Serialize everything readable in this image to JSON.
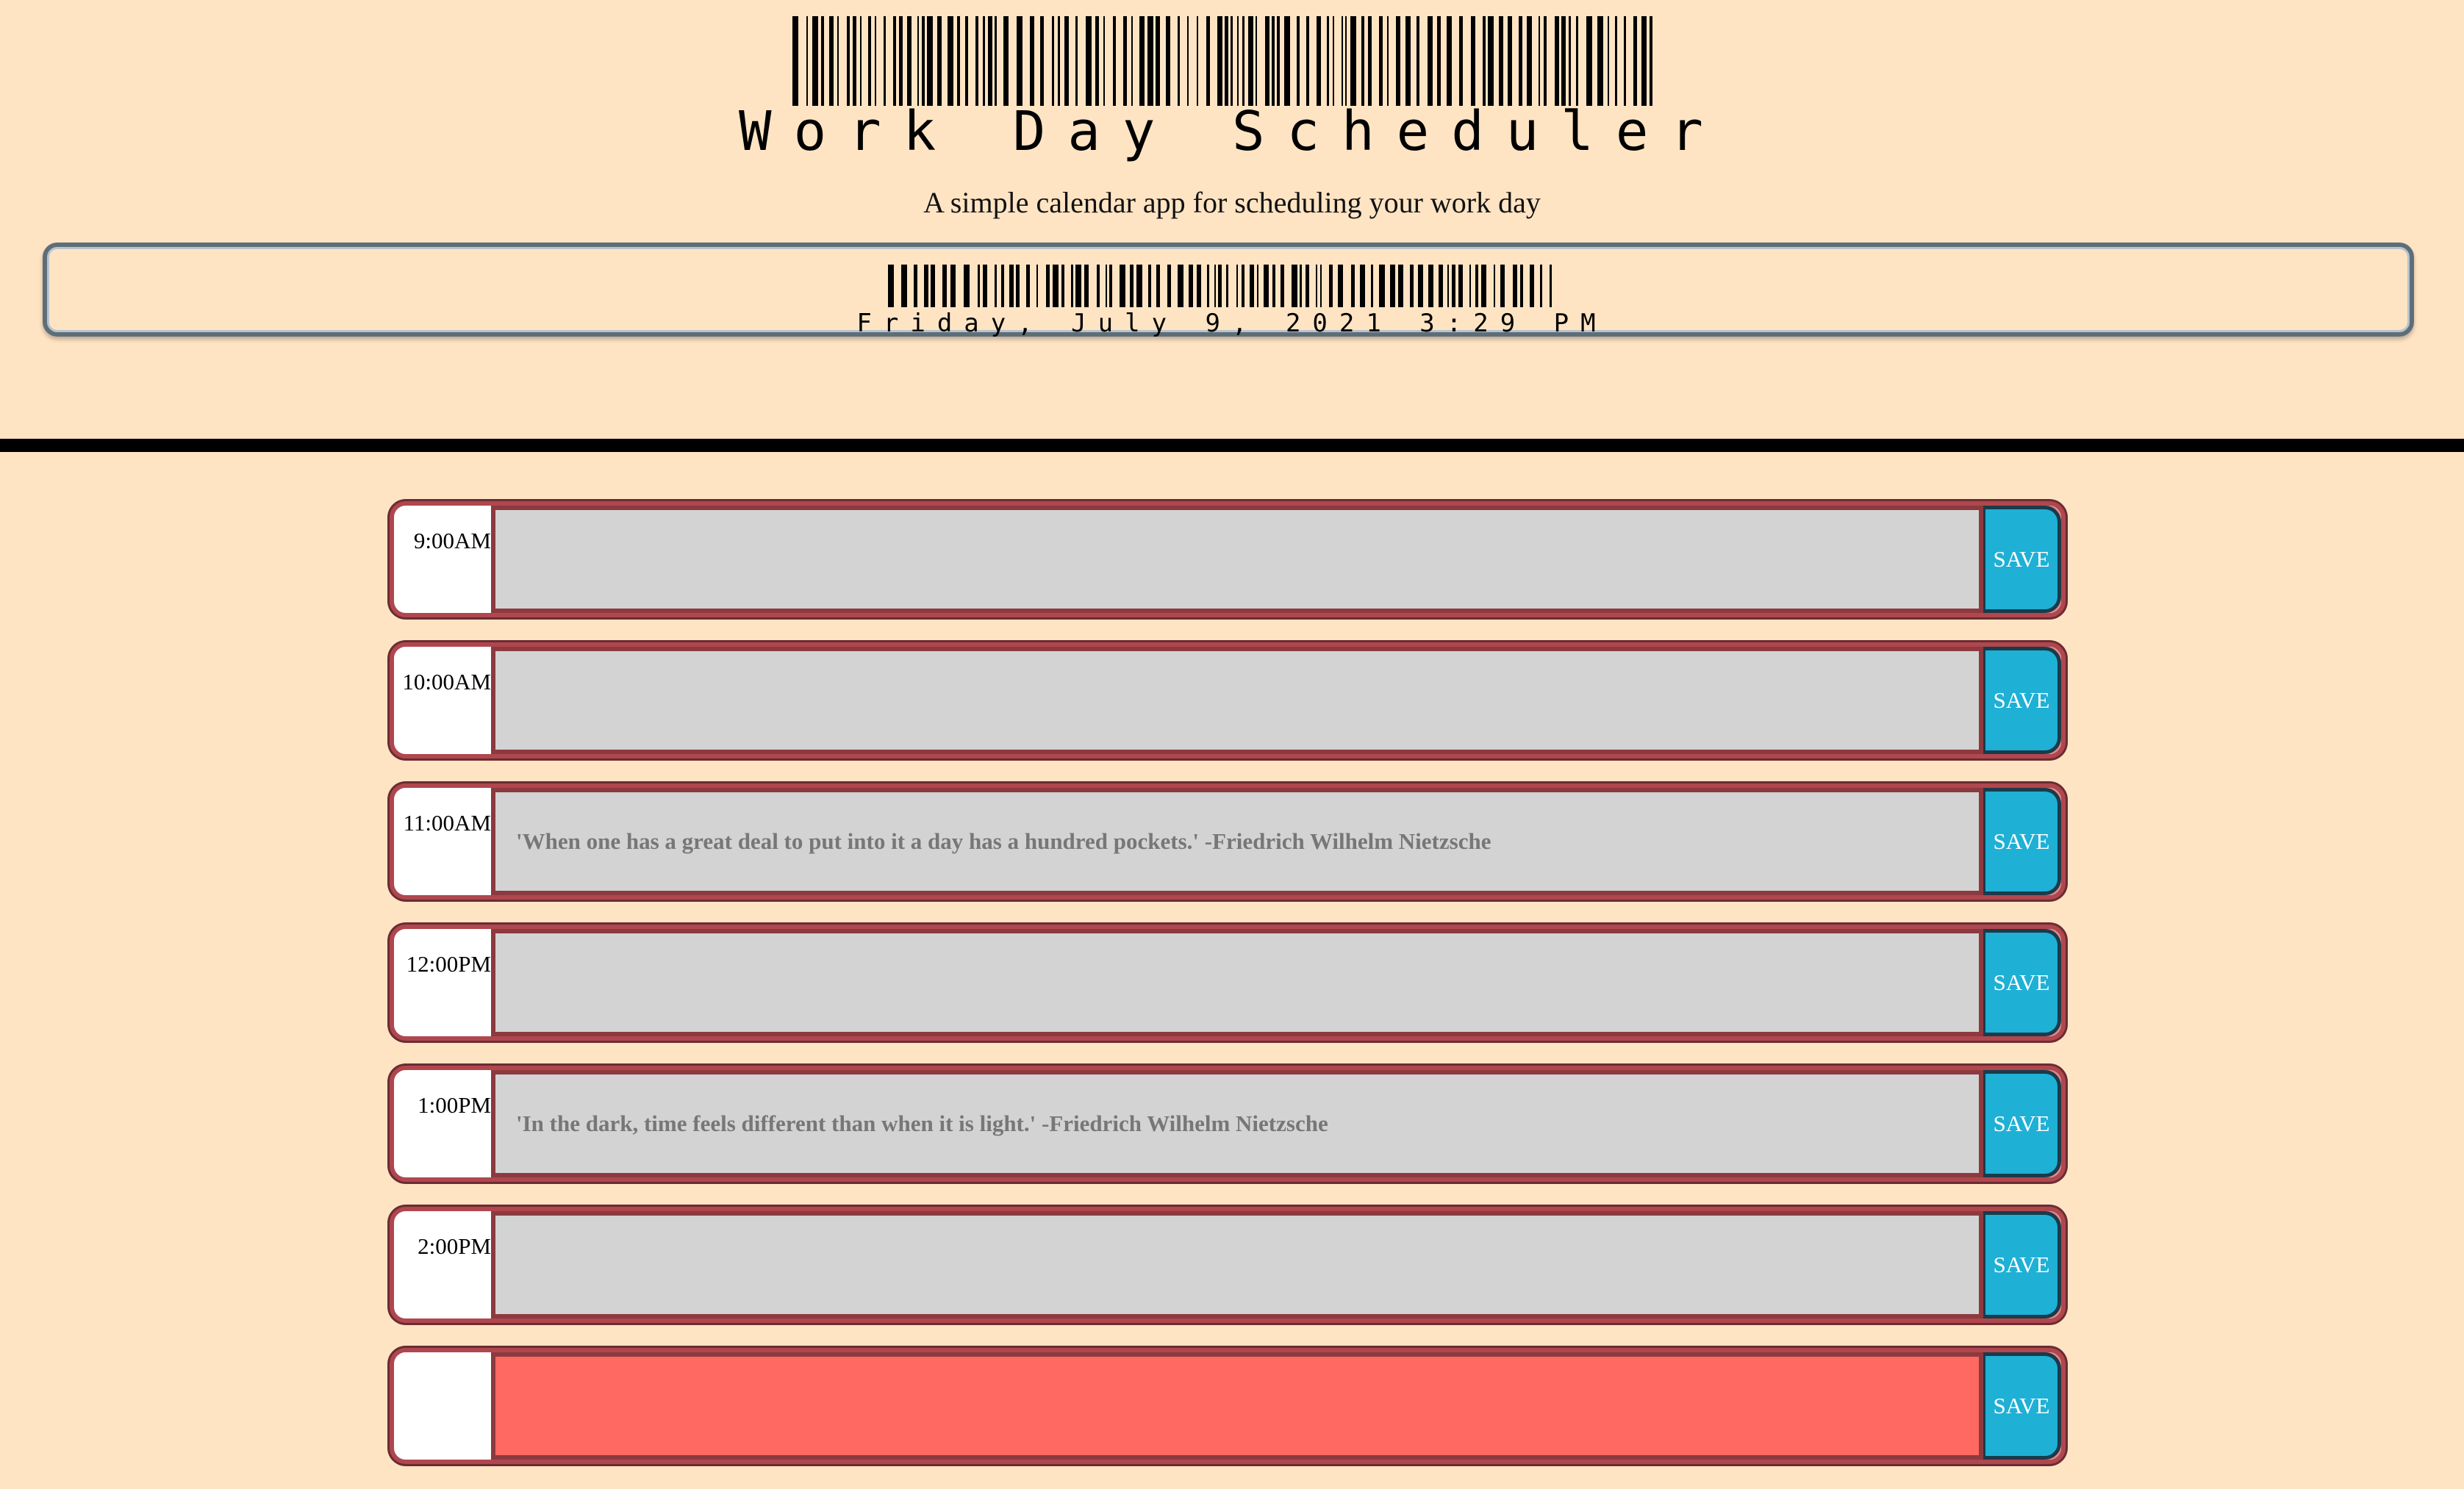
{
  "header": {
    "title": "Work Day Scheduler",
    "lead": "A simple calendar app for scheduling your work day",
    "current_date": "Friday, July 9, 2021 3:29 PM"
  },
  "schedule": {
    "save_label": "SAVE",
    "blocks": [
      {
        "hour": "9:00AM",
        "text": ""
      },
      {
        "hour": "10:00AM",
        "text": ""
      },
      {
        "hour": "11:00AM",
        "text": "'When one has a great deal to put into it a day has a hundred pockets.' -Friedrich Wilhelm Nietzsche"
      },
      {
        "hour": "12:00PM",
        "text": ""
      },
      {
        "hour": "1:00PM",
        "text": "'In the dark, time feels different than when it is light.' -Friedrich Wilhelm Nietzsche"
      },
      {
        "hour": "2:00PM",
        "text": ""
      },
      {
        "hour": "",
        "text": ""
      }
    ]
  },
  "colors": {
    "page_background": "#ffe4c4",
    "past_block": "#d3d3d3",
    "present_block": "#ff6961",
    "save_button": "#1fb0d5",
    "block_border": "#b0474e"
  }
}
